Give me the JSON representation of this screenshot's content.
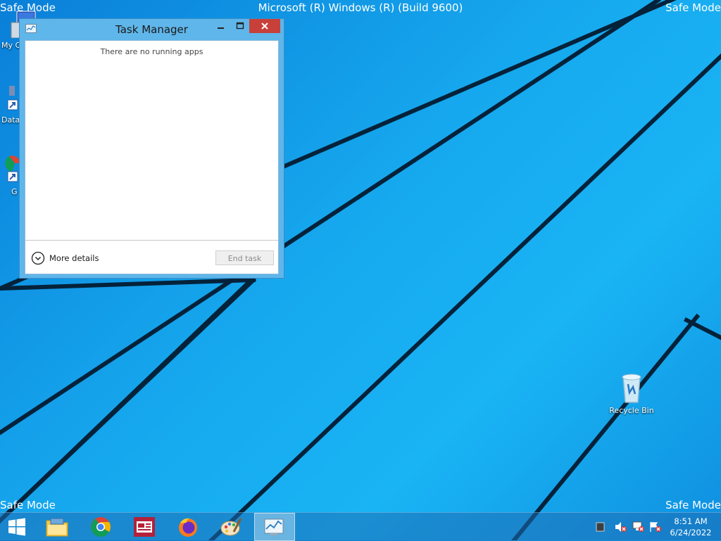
{
  "desktop": {
    "safe_mode_label": "Safe Mode",
    "build_text": "Microsoft (R) Windows (R) (Build 9600)",
    "icons": [
      {
        "label": "My C"
      },
      {
        "label": "Data"
      },
      {
        "label": "G C"
      },
      {
        "label": "Recycle Bin"
      }
    ]
  },
  "task_manager": {
    "title": "Task Manager",
    "empty_message": "There are no running apps",
    "more_details_label": "More details",
    "end_task_label": "End task"
  },
  "taskbar": {
    "pinned": [
      "start",
      "file-explorer",
      "chrome",
      "news",
      "firefox",
      "paint",
      "task-manager"
    ],
    "clock_time": "8:51 AM",
    "clock_date": "6/24/2022"
  },
  "colors": {
    "close_button": "#c7403a",
    "window_frame": "#5fb6ea",
    "desktop": "#19b4f4"
  }
}
